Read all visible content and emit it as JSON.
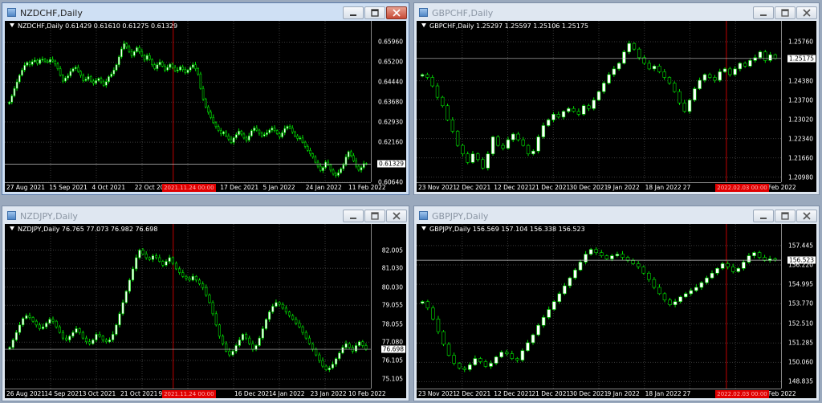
{
  "windows": [
    {
      "title": "NZDCHF,Daily",
      "symbol_line": "NZDCHF,Daily  0.61429 0.61610 0.61275 0.61329",
      "active": true,
      "price_current": "0.61329",
      "y_labels": [
        "0.65960",
        "0.65200",
        "0.64440",
        "0.63680",
        "0.62930",
        "0.62160",
        "0.60640"
      ],
      "x_labels": [
        "27 Aug 2021",
        "15 Sep 2021",
        "4 Oct 2021",
        "22 Oct 2021",
        "v 2021",
        "17 Dec 2021",
        "5 Jan 2022",
        "24 Jan 2022",
        "11 Feb 2022"
      ],
      "x_red_label": "2021.11.24 00:00",
      "chart_data": {
        "type": "candlestick",
        "ylim": [
          0.6064,
          0.6634
        ],
        "closes": [
          0.6368,
          0.6392,
          0.642,
          0.6445,
          0.647,
          0.649,
          0.6508,
          0.6519,
          0.6511,
          0.6522,
          0.6527,
          0.6515,
          0.6529,
          0.6531,
          0.6524,
          0.652,
          0.653,
          0.6524,
          0.6513,
          0.6495,
          0.647,
          0.6448,
          0.646,
          0.6468,
          0.6485,
          0.6495,
          0.65,
          0.6485,
          0.647,
          0.645,
          0.6455,
          0.6465,
          0.6448,
          0.644,
          0.645,
          0.6458,
          0.6445,
          0.6432,
          0.6446,
          0.6465,
          0.6475,
          0.649,
          0.651,
          0.654,
          0.657,
          0.659,
          0.6578,
          0.656,
          0.6545,
          0.656,
          0.6575,
          0.656,
          0.6545,
          0.653,
          0.6545,
          0.653,
          0.651,
          0.6495,
          0.651,
          0.652,
          0.6505,
          0.649,
          0.65,
          0.6512,
          0.65,
          0.6487,
          0.649,
          0.6502,
          0.6492,
          0.648,
          0.649,
          0.65,
          0.651,
          0.6495,
          0.6475,
          0.642,
          0.638,
          0.635,
          0.633,
          0.631,
          0.629,
          0.6275,
          0.626,
          0.6248,
          0.6255,
          0.624,
          0.6228,
          0.6215,
          0.6233,
          0.6245,
          0.6258,
          0.6247,
          0.6232,
          0.6224,
          0.624,
          0.626,
          0.627,
          0.6262,
          0.625,
          0.624,
          0.6245,
          0.6252,
          0.6262,
          0.627,
          0.626,
          0.6248,
          0.6236,
          0.6252,
          0.6268,
          0.6276,
          0.627,
          0.6255,
          0.624,
          0.623,
          0.6232,
          0.6216,
          0.62,
          0.6185,
          0.6172,
          0.616,
          0.614,
          0.6125,
          0.6108,
          0.612,
          0.614,
          0.613,
          0.611,
          0.6095,
          0.609,
          0.61,
          0.6115,
          0.613,
          0.616,
          0.618,
          0.6165,
          0.6145,
          0.6125,
          0.611,
          0.612,
          0.6135,
          0.6133
        ]
      }
    },
    {
      "title": "GBPCHF,Daily",
      "symbol_line": "GBPCHF,Daily  1.25297 1.25597 1.25106 1.25175",
      "active": false,
      "price_current": "1.25175",
      "y_labels": [
        "1.25760",
        "1.24380",
        "1.23700",
        "1.23020",
        "1.22340",
        "1.21660",
        "1.20980"
      ],
      "x_labels": [
        "23 Nov 2021",
        "2 Dec 2021",
        "12 Dec 2021",
        "21 Dec 2021",
        "30 Dec 2021",
        "9 Jan 2022",
        "18 Jan 2022",
        "27",
        "2022",
        "15 Feb 2022"
      ],
      "x_red_label": "2022.02.03 00:00",
      "chart_data": {
        "type": "candlestick",
        "ylim": [
          1.208,
          1.261
        ],
        "closes": [
          1.246,
          1.245,
          1.242,
          1.238,
          1.235,
          1.23,
          1.226,
          1.221,
          1.218,
          1.215,
          1.218,
          1.216,
          1.213,
          1.218,
          1.224,
          1.221,
          1.22,
          1.223,
          1.225,
          1.223,
          1.221,
          1.218,
          1.219,
          1.224,
          1.228,
          1.23,
          1.232,
          1.231,
          1.233,
          1.234,
          1.233,
          1.232,
          1.235,
          1.234,
          1.237,
          1.24,
          1.243,
          1.246,
          1.248,
          1.25,
          1.254,
          1.257,
          1.255,
          1.252,
          1.25,
          1.248,
          1.249,
          1.247,
          1.245,
          1.243,
          1.24,
          1.236,
          1.233,
          1.237,
          1.241,
          1.244,
          1.246,
          1.245,
          1.244,
          1.247,
          1.248,
          1.246,
          1.248,
          1.25,
          1.249,
          1.251,
          1.252,
          1.254,
          1.251,
          1.253,
          1.2517
        ]
      }
    },
    {
      "title": "NZDJPY,Daily",
      "symbol_line": "NZDJPY,Daily  76.765 77.073 76.982 76.698",
      "active": false,
      "price_current": "76.698",
      "y_labels": [
        "82.005",
        "81.030",
        "80.030",
        "79.055",
        "78.055",
        "77.080",
        "76.105",
        "75.105"
      ],
      "x_labels": [
        "26 Aug 2021",
        "14 Sep 2021",
        "3 Oct 2021",
        "21 Oct 2021",
        "9 N",
        "2021",
        "16 Dec 2021",
        "4 Jan 2022",
        "23 Jan 2022",
        "10 Feb 2022"
      ],
      "x_red_label": "2021.11.24 00:00",
      "chart_data": {
        "type": "candlestick",
        "ylim": [
          74.6,
          82.8
        ],
        "closes": [
          76.8,
          77.2,
          77.6,
          78.0,
          78.35,
          78.5,
          78.4,
          78.2,
          78.0,
          77.8,
          77.9,
          78.1,
          78.3,
          78.2,
          77.9,
          77.6,
          77.3,
          77.2,
          77.4,
          77.6,
          77.8,
          77.6,
          77.3,
          77.1,
          77.0,
          77.2,
          77.5,
          77.4,
          77.2,
          77.1,
          77.2,
          77.5,
          78.0,
          78.6,
          79.2,
          79.8,
          80.4,
          81.0,
          81.6,
          82.0,
          81.8,
          81.6,
          81.5,
          81.7,
          81.6,
          81.4,
          81.2,
          81.4,
          81.6,
          81.3,
          81.0,
          80.8,
          80.6,
          80.5,
          80.4,
          80.6,
          80.4,
          80.2,
          80.0,
          79.6,
          79.2,
          78.6,
          78.0,
          77.4,
          77.0,
          76.6,
          76.4,
          76.6,
          76.9,
          77.2,
          77.5,
          77.3,
          77.0,
          76.7,
          76.9,
          77.3,
          77.8,
          78.3,
          78.7,
          79.0,
          79.2,
          79.1,
          78.9,
          78.7,
          78.5,
          78.3,
          78.1,
          77.9,
          77.6,
          77.3,
          77.0,
          76.7,
          76.4,
          76.1,
          75.8,
          75.6,
          75.7,
          75.9,
          76.2,
          76.5,
          76.8,
          77.0,
          76.8,
          76.6,
          76.9,
          77.1,
          76.9,
          76.7
        ]
      }
    },
    {
      "title": "GBPJPY,Daily",
      "symbol_line": "GBPJPY,Daily  156.569 157.104 156.338 156.523",
      "active": false,
      "price_current": "156.523",
      "y_labels": [
        "157.445",
        "156.220",
        "154.995",
        "153.770",
        "152.510",
        "151.285",
        "150.060",
        "148.835"
      ],
      "x_labels": [
        "23 Nov 2021",
        "2 Dec 2021",
        "12 Dec 2021",
        "21 Dec 2021",
        "30 Dec 2021",
        "9 Jan 2022",
        "18 Jan 2022",
        "27",
        "2022",
        "15 Feb 2022"
      ],
      "x_red_label": "2022.02.03 00:00",
      "chart_data": {
        "type": "candlestick",
        "ylim": [
          148.4,
          158.1
        ],
        "closes": [
          153.9,
          153.5,
          152.8,
          152.0,
          151.2,
          150.5,
          150.0,
          149.7,
          149.6,
          149.9,
          150.3,
          150.1,
          149.8,
          150.0,
          150.4,
          150.7,
          150.6,
          150.3,
          150.2,
          150.8,
          151.3,
          151.8,
          152.4,
          152.9,
          153.4,
          153.9,
          154.4,
          154.9,
          155.4,
          155.9,
          156.4,
          156.9,
          157.2,
          157.0,
          156.8,
          156.6,
          156.8,
          156.9,
          156.7,
          156.5,
          156.3,
          156.1,
          155.7,
          155.3,
          154.8,
          154.4,
          154.0,
          153.7,
          153.9,
          154.2,
          154.4,
          154.6,
          154.8,
          155.1,
          155.4,
          155.7,
          156.0,
          156.3,
          156.1,
          155.8,
          156.0,
          156.4,
          156.8,
          157.0,
          156.7,
          156.5,
          156.6,
          156.52
        ]
      }
    }
  ]
}
